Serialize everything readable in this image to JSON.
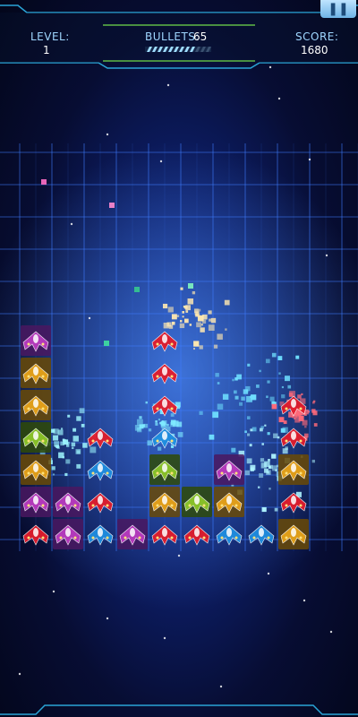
{
  "hud": {
    "level_label": "LEVEL:",
    "level_value": "1",
    "bullets_label": "BULLETS:",
    "bullets_value": "65",
    "score_label": "SCORE:",
    "score_value": "1680",
    "pause_icon": "pause-icon",
    "ammo_fill_fraction": 0.75
  },
  "colors": {
    "grid_line": "#3f7cff",
    "hud_accent": "#2aa4d6",
    "hud_green": "#6cd24a",
    "cell_red": "#e21c2c",
    "cell_gold": "#e6a21a",
    "cell_purple": "#b93bbf",
    "cell_blue": "#1f8ee0",
    "cell_green": "#8cc62a"
  },
  "board": {
    "columns": 10,
    "rows": 7,
    "cells": [
      [
        "purple",
        null,
        null,
        null,
        "red",
        null,
        null,
        null,
        null,
        null
      ],
      [
        "gold",
        null,
        null,
        null,
        "red",
        null,
        null,
        null,
        null,
        null
      ],
      [
        "gold",
        null,
        null,
        null,
        "red",
        null,
        null,
        null,
        "red",
        null
      ],
      [
        "green",
        null,
        "red",
        null,
        "blue",
        null,
        null,
        null,
        "red",
        null
      ],
      [
        "gold",
        null,
        "blue",
        null,
        "green",
        null,
        "purple",
        null,
        "gold",
        null
      ],
      [
        "purple",
        "purple",
        "red",
        null,
        "gold",
        "green",
        "gold",
        null,
        "red",
        null
      ],
      [
        "red",
        "purple",
        "blue",
        "purple",
        "red",
        "red",
        "blue",
        "blue",
        "gold",
        null
      ]
    ]
  }
}
